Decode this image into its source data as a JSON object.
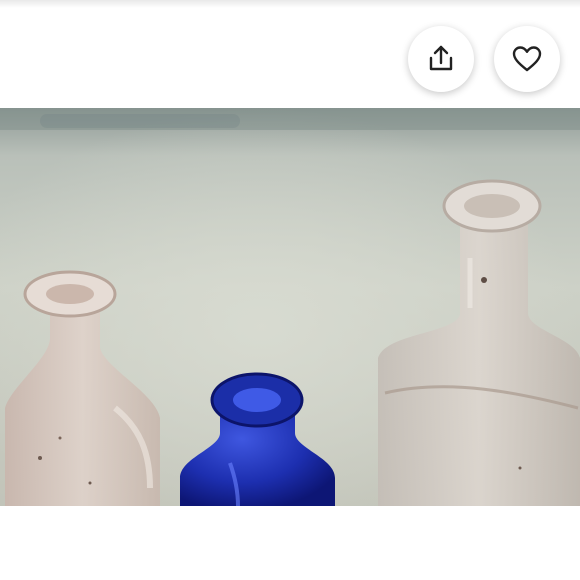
{
  "toolbar": {
    "share_icon": "share-icon",
    "favorite_icon": "heart-icon"
  },
  "photo": {
    "subject": "glass-bottles",
    "colors": {
      "background": "#c9cdc3",
      "cobalt_bottle": "#1d2fb0",
      "clear_glass": "#d7d0c9"
    }
  }
}
